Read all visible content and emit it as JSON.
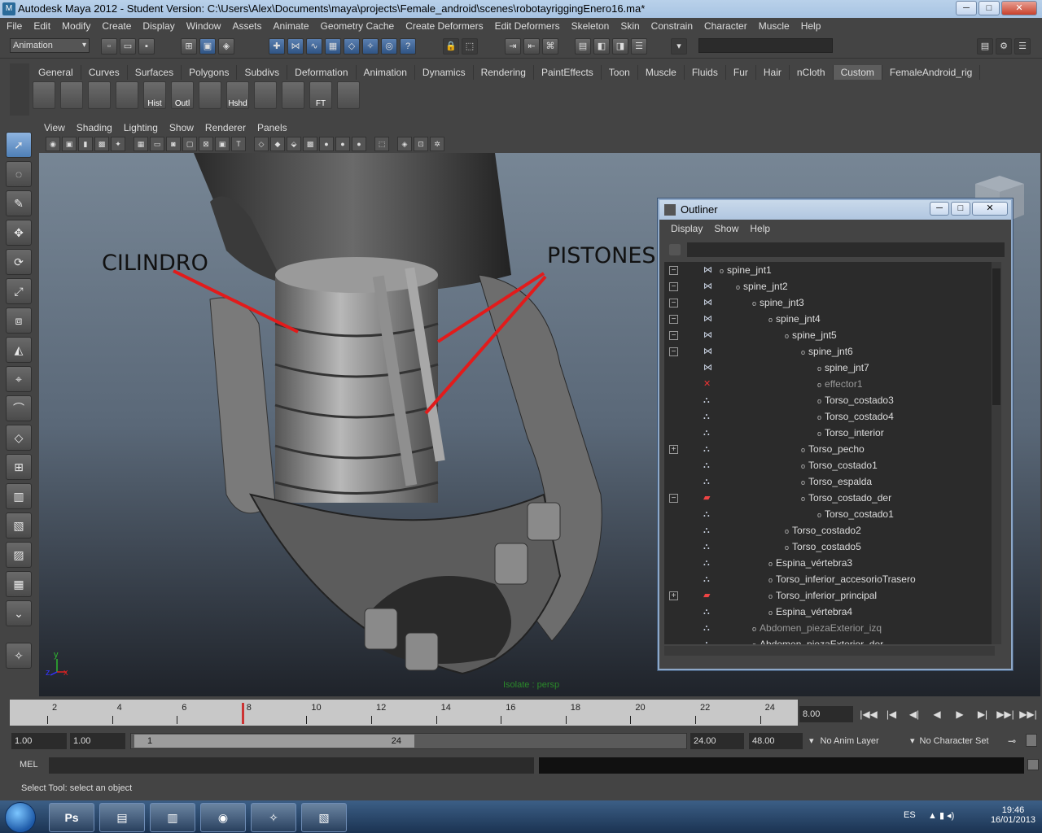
{
  "window": {
    "title": "Autodesk Maya 2012 - Student Version: C:\\Users\\Alex\\Documents\\maya\\projects\\Female_android\\scenes\\robotayriggingEnero16.ma*",
    "min": "─",
    "max": "□",
    "close": "✕"
  },
  "menu": [
    "File",
    "Edit",
    "Modify",
    "Create",
    "Display",
    "Window",
    "Assets",
    "Animate",
    "Geometry Cache",
    "Create Deformers",
    "Edit Deformers",
    "Skeleton",
    "Skin",
    "Constrain",
    "Character",
    "Muscle",
    "Help"
  ],
  "mode_selector": "Animation",
  "shelf_tabs": [
    "General",
    "Curves",
    "Surfaces",
    "Polygons",
    "Subdivs",
    "Deformation",
    "Animation",
    "Dynamics",
    "Rendering",
    "PaintEffects",
    "Toon",
    "Muscle",
    "Fluids",
    "Fur",
    "Hair",
    "nCloth",
    "Custom",
    "FemaleAndroid_rig"
  ],
  "shelf_active_tab": "Custom",
  "shelf_buttons": [
    "",
    "",
    "",
    "",
    "Hist",
    "Outl",
    "",
    "Hshd",
    "",
    "",
    "FT",
    ""
  ],
  "viewport": {
    "menu": [
      "View",
      "Shading",
      "Lighting",
      "Show",
      "Renderer",
      "Panels"
    ],
    "isolate_label": "Isolate : persp",
    "annotations": [
      "CILINDRO",
      "PISTONES"
    ]
  },
  "outliner": {
    "title": "Outliner",
    "menu": [
      "Display",
      "Show",
      "Help"
    ],
    "rows": [
      {
        "label": "spine_jnt1",
        "depth": 0,
        "exp": "minus",
        "icon": "joint"
      },
      {
        "label": "spine_jnt2",
        "depth": 1,
        "exp": "minus",
        "icon": "joint"
      },
      {
        "label": "spine_jnt3",
        "depth": 2,
        "exp": "minus",
        "icon": "joint"
      },
      {
        "label": "spine_jnt4",
        "depth": 3,
        "exp": "minus",
        "icon": "joint"
      },
      {
        "label": "spine_jnt5",
        "depth": 4,
        "exp": "minus",
        "icon": "joint"
      },
      {
        "label": "spine_jnt6",
        "depth": 5,
        "exp": "minus",
        "icon": "joint"
      },
      {
        "label": "spine_jnt7",
        "depth": 6,
        "exp": "",
        "icon": "joint"
      },
      {
        "label": "effector1",
        "depth": 6,
        "exp": "",
        "icon": "effector",
        "dim": true
      },
      {
        "label": "Torso_costado3",
        "depth": 6,
        "exp": "",
        "icon": "mesh"
      },
      {
        "label": "Torso_costado4",
        "depth": 6,
        "exp": "",
        "icon": "mesh"
      },
      {
        "label": "Torso_interior",
        "depth": 6,
        "exp": "",
        "icon": "mesh"
      },
      {
        "label": "Torso_pecho",
        "depth": 5,
        "exp": "plus",
        "icon": "mesh"
      },
      {
        "label": "Torso_costado1",
        "depth": 5,
        "exp": "",
        "icon": "mesh"
      },
      {
        "label": "Torso_espalda",
        "depth": 5,
        "exp": "",
        "icon": "mesh"
      },
      {
        "label": "Torso_costado_der",
        "depth": 5,
        "exp": "minus",
        "icon": "group"
      },
      {
        "label": "Torso_costado1",
        "depth": 6,
        "exp": "",
        "icon": "mesh"
      },
      {
        "label": "Torso_costado2",
        "depth": 4,
        "exp": "",
        "icon": "mesh"
      },
      {
        "label": "Torso_costado5",
        "depth": 4,
        "exp": "",
        "icon": "mesh"
      },
      {
        "label": "Espina_vértebra3",
        "depth": 3,
        "exp": "",
        "icon": "mesh"
      },
      {
        "label": "Torso_inferior_accesorioTrasero",
        "depth": 3,
        "exp": "",
        "icon": "mesh"
      },
      {
        "label": "Torso_inferior_principal",
        "depth": 3,
        "exp": "plus",
        "icon": "group"
      },
      {
        "label": "Espina_vértebra4",
        "depth": 3,
        "exp": "",
        "icon": "mesh"
      },
      {
        "label": "Abdomen_piezaExterior_izq",
        "depth": 2,
        "exp": "",
        "icon": "mesh",
        "dim": true
      },
      {
        "label": "Abdomen_piezaExterior_der",
        "depth": 2,
        "exp": "",
        "icon": "mesh"
      }
    ]
  },
  "timeline": {
    "ticks": [
      "2",
      "4",
      "6",
      "8",
      "10",
      "12",
      "14",
      "16",
      "18",
      "20",
      "22",
      "24"
    ],
    "current_frame": "8.00",
    "play_buttons": [
      "|◀◀",
      "|◀",
      "◀|",
      "◀",
      "▶",
      "▶|",
      "▶▶|",
      "▶▶|"
    ]
  },
  "range": {
    "start_field": "1.00",
    "playback_start": "1.00",
    "handle_start": "1",
    "handle_end": "24",
    "playback_end": "24.00",
    "end_field": "48.00",
    "anim_layer": "No Anim Layer",
    "char_set": "No Character Set"
  },
  "mel_label": "MEL",
  "help_line": "Select Tool: select an object",
  "taskbar": {
    "apps": [
      "",
      "Ps",
      "",
      "",
      "",
      "",
      ""
    ],
    "lang": "ES",
    "time": "19:46",
    "date": "16/01/2013"
  }
}
